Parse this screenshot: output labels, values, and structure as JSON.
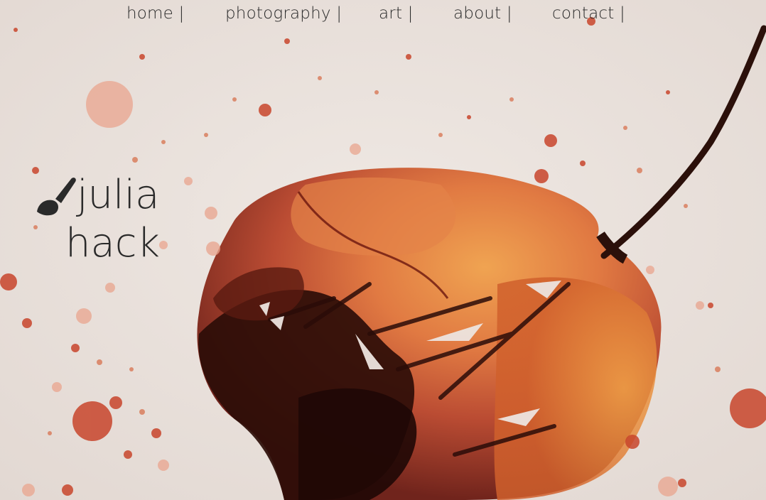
{
  "nav": {
    "items": [
      {
        "label": "home |"
      },
      {
        "label": "photography |"
      },
      {
        "label": "art |"
      },
      {
        "label": "about |"
      },
      {
        "label": "contact |"
      }
    ]
  },
  "logo": {
    "icon": "paintbrush-icon",
    "line1": "julia",
    "line2": "hack"
  },
  "colors": {
    "background": "#ece4df",
    "ink_dark": "#2a0f0a",
    "ink_red": "#a3301f",
    "ink_orange": "#e07a3a",
    "text": "#2b2b2b"
  }
}
